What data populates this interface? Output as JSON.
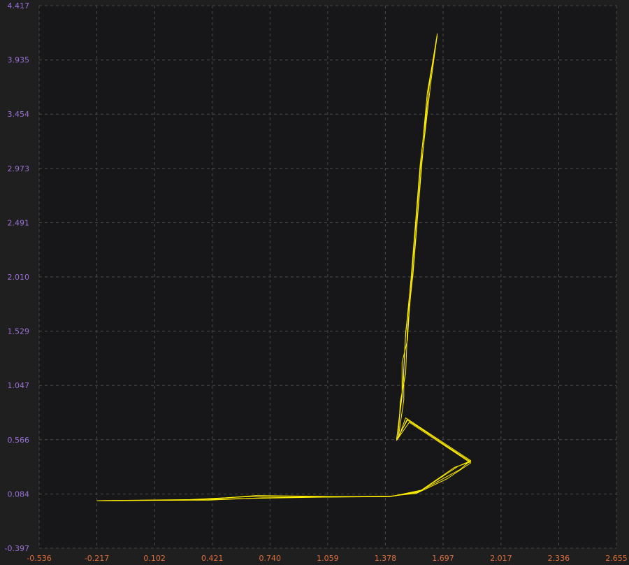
{
  "chart_data": {
    "type": "line",
    "title": "",
    "xlabel": "",
    "ylabel": "",
    "xlim": [
      -0.536,
      2.655
    ],
    "ylim": [
      -0.397,
      4.417
    ],
    "grid": true,
    "x_ticks": [
      "-0.536",
      "-0.217",
      "0.102",
      "0.421",
      "0.740",
      "1.059",
      "1.378",
      "1.697",
      "2.017",
      "2.336",
      "2.655"
    ],
    "y_ticks": [
      "-0.397",
      "0.084",
      "0.566",
      "1.047",
      "1.529",
      "2.010",
      "2.491",
      "2.973",
      "3.454",
      "3.935",
      "4.417"
    ],
    "colors": {
      "background": "#1f1f1f",
      "plot_bg": "#171719",
      "line": "#ffee00",
      "grid": "#4a4a4a",
      "y_tick": "#9a6fd6",
      "x_tick": "#e0703a"
    },
    "series": [
      {
        "x": [
          -0.217,
          0.3,
          0.68,
          1.05,
          1.4,
          1.56,
          1.76,
          1.85,
          1.5,
          1.44,
          1.47,
          1.48,
          1.49,
          1.52,
          1.57,
          1.62,
          1.665
        ],
        "y": [
          0.025,
          0.035,
          0.065,
          0.06,
          0.06,
          0.1,
          0.32,
          0.37,
          0.74,
          0.57,
          0.95,
          1.2,
          1.5,
          2.0,
          3.0,
          3.7,
          4.17
        ]
      },
      {
        "x": [
          -0.217,
          0.4,
          0.7,
          1.1,
          1.42,
          1.57,
          1.78,
          1.85,
          1.49,
          1.45,
          1.46,
          1.49,
          1.5,
          1.53,
          1.58,
          1.63,
          1.66
        ],
        "y": [
          0.025,
          0.03,
          0.05,
          0.06,
          0.065,
          0.11,
          0.33,
          0.38,
          0.76,
          0.58,
          0.9,
          1.15,
          1.55,
          2.05,
          3.05,
          3.75,
          4.1
        ]
      },
      {
        "x": [
          -0.217,
          0.25,
          0.62,
          1.0,
          1.38,
          1.55,
          1.72,
          1.85,
          1.51,
          1.44,
          1.47,
          1.47,
          1.5,
          1.52,
          1.57,
          1.61,
          1.665
        ],
        "y": [
          0.025,
          0.03,
          0.045,
          0.055,
          0.06,
          0.09,
          0.22,
          0.36,
          0.72,
          0.56,
          0.98,
          1.25,
          1.45,
          1.95,
          2.95,
          3.65,
          4.15
        ]
      },
      {
        "x": [
          -0.217,
          0.35,
          0.66,
          1.08,
          1.41,
          1.58,
          1.79,
          1.84,
          1.5,
          1.45,
          1.48,
          1.48,
          1.49,
          1.53,
          1.58,
          1.62,
          1.66
        ],
        "y": [
          0.025,
          0.032,
          0.07,
          0.062,
          0.062,
          0.12,
          0.3,
          0.37,
          0.75,
          0.59,
          0.92,
          1.18,
          1.52,
          2.02,
          3.02,
          3.72,
          4.12
        ]
      }
    ]
  }
}
